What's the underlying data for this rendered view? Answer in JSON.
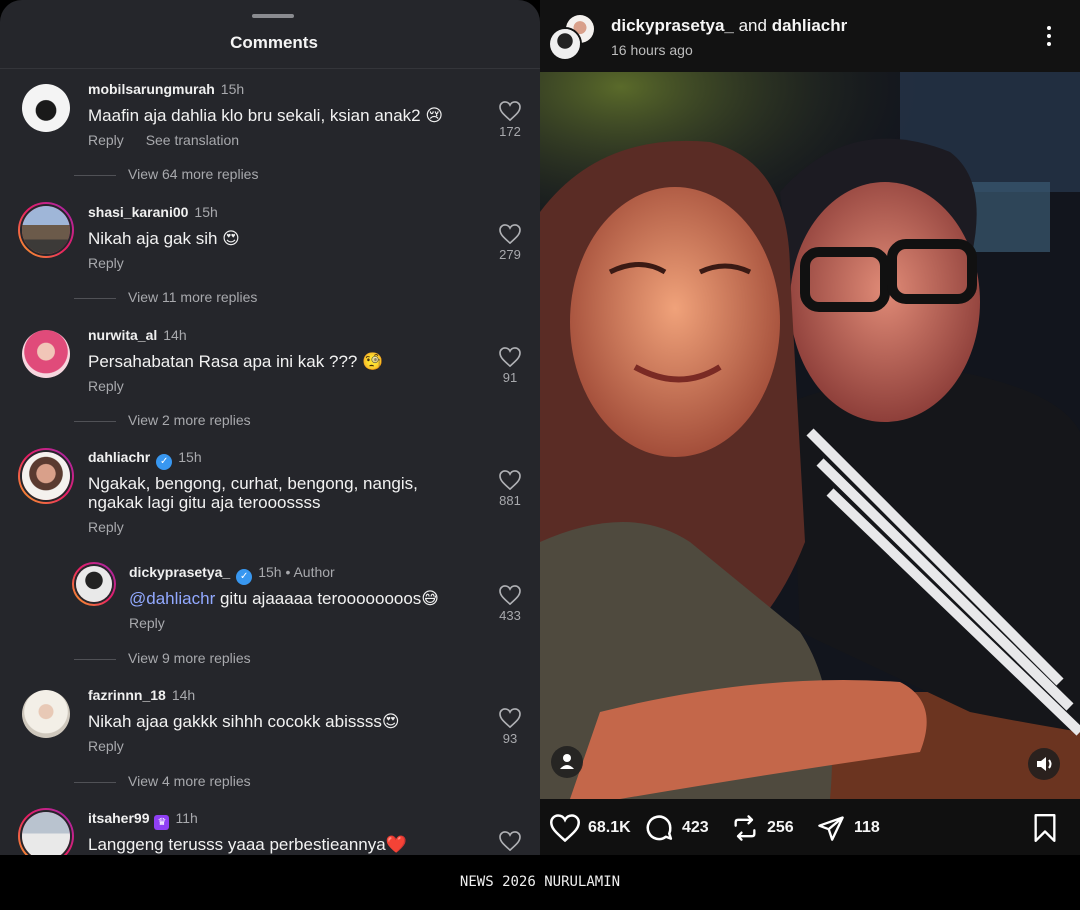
{
  "sheet": {
    "title": "Comments"
  },
  "comments": [
    {
      "username": "mobilsarungmurah",
      "time": "15h",
      "text": "Maafin aja dahlia klo bru sekali, ksian anak2 😢",
      "reply": "Reply",
      "translate": "See translation",
      "likes": "172",
      "more": "View 64 more replies"
    },
    {
      "username": "shasi_karani00",
      "time": "15h",
      "text": "Nikah aja gak sih 😍",
      "reply": "Reply",
      "likes": "279",
      "more": "View 11 more replies"
    },
    {
      "username": "nurwita_al",
      "time": "14h",
      "text": "Persahabatan Rasa apa ini kak ??? 🧐",
      "reply": "Reply",
      "likes": "91",
      "more": "View 2 more replies"
    },
    {
      "username": "dahliachr",
      "time": "15h",
      "text": "Ngakak, bengong, curhat, bengong, nangis, ngakak lagi gitu aja terooossss",
      "reply": "Reply",
      "likes": "881"
    },
    {
      "username": "dickyprasetya_",
      "time": "15h",
      "author": "• Author",
      "mention": "@dahliachr",
      "text": " gitu ajaaaaa teroooooooos😅",
      "reply": "Reply",
      "likes": "433",
      "more": "View 9 more replies"
    },
    {
      "username": "fazrinnn_18",
      "time": "14h",
      "text": "Nikah ajaa gakkk sihhh cocokk abissss😍",
      "reply": "Reply",
      "likes": "93",
      "more": "View 4 more replies"
    },
    {
      "username": "itsaher99",
      "time": "11h",
      "text": "Langgeng terusss yaaa perbestieannya❤️"
    }
  ],
  "post": {
    "user1": "dickyprasetya_",
    "joiner": " and ",
    "user2": "dahliachr",
    "time": "16 hours ago",
    "likes": "68.1K",
    "comments": "423",
    "reposts": "256",
    "shares": "118"
  },
  "footer": {
    "text": "NEWS 2026 NURULAMIN"
  },
  "icons": [
    "heart-icon",
    "comment-icon",
    "repost-icon",
    "share-icon",
    "bookmark-icon",
    "more-icon",
    "user-tag-icon",
    "sound-icon",
    "verified-icon",
    "crown-icon"
  ],
  "colors": {
    "sheet_bg": "#25262b",
    "mention": "#92a9ff",
    "verified": "#3897f0"
  }
}
